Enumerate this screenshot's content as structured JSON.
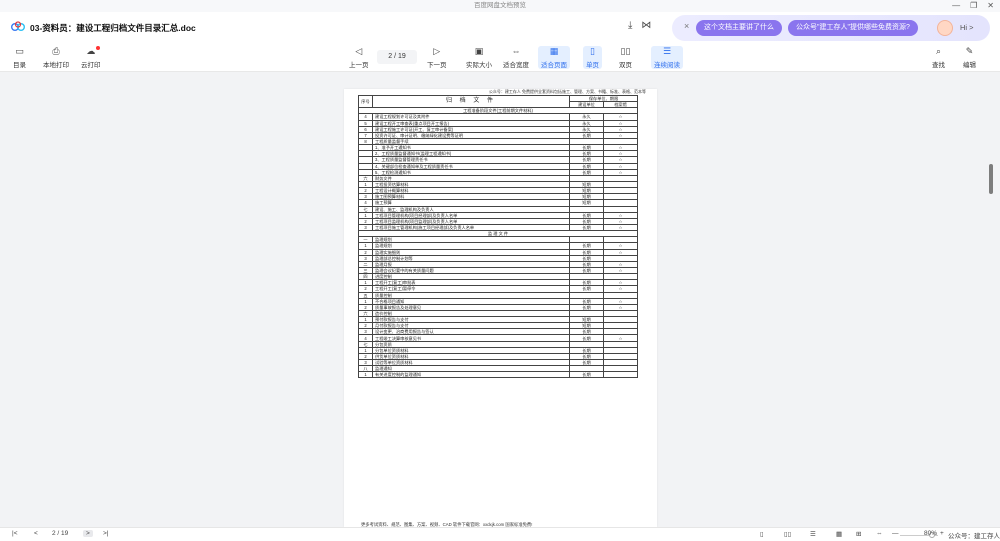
{
  "system": {
    "title": "百度网盘文档预览",
    "controls": [
      "—",
      "❐",
      "✕"
    ]
  },
  "app": {
    "doc_title": "03-资料员：建设工程归档文件目录汇总.doc",
    "title_icons": [
      "download-icon",
      "share-icon"
    ],
    "ai": {
      "close": "×",
      "q1": "这个文档主要讲了什么",
      "q2": "公众号\"建工存人\"提供哪些免费资源?",
      "hi": "Hi >"
    }
  },
  "toolbar": {
    "left": [
      {
        "name": "toc",
        "label": "目录",
        "icon": "▭"
      },
      {
        "name": "local-print",
        "label": "本地打印",
        "icon": "⎙"
      },
      {
        "name": "cloud-print",
        "label": "云打印",
        "icon": "☁"
      }
    ],
    "prev": {
      "label": "上一页",
      "icon": "◁"
    },
    "page_indicator": "2  /  19",
    "next": {
      "label": "下一页",
      "icon": "▷"
    },
    "view": [
      {
        "name": "actual-size",
        "label": "实际大小",
        "icon": "▣"
      },
      {
        "name": "fit-width",
        "label": "适合宽度",
        "icon": "⇔"
      },
      {
        "name": "fit-page",
        "label": "适合页面",
        "icon": "▦"
      },
      {
        "name": "single-page",
        "label": "单页",
        "icon": "▯"
      },
      {
        "name": "double-page",
        "label": "双页",
        "icon": "▯▯"
      },
      {
        "name": "continuous",
        "label": "连续阅读",
        "icon": "☰"
      }
    ],
    "right": [
      {
        "name": "find",
        "label": "查找",
        "icon": "⌕"
      },
      {
        "name": "edit",
        "label": "编辑",
        "icon": "✎"
      }
    ]
  },
  "doc": {
    "header_note": "公众号：建工存人 免费提供全套资料包括施工、管理、方案、书籍、标准、表格、范本等",
    "table_head": {
      "num": "序号",
      "title": "归 档 文 件",
      "keep": "保存单位、期限",
      "build": "建设单位",
      "archive": "档案馆"
    },
    "rows": [
      [
        "",
        "工程准备阶段文件(工程前期文件材料)",
        "",
        ""
      ],
      [
        "4",
        "建设工程规划许可证及其附件",
        "永久",
        "☆"
      ],
      [
        "5",
        "建设工程开工审查表(重点项目开工报告)",
        "永久",
        "☆"
      ],
      [
        "6",
        "建设工程施工许可证(开工、复工审计备案)",
        "永久",
        "☆"
      ],
      [
        "7",
        "投资许可证、审计证明、缴纳绿化建设费等证明",
        "长期",
        "☆"
      ],
      [
        "8",
        "工程质量监督手续",
        "",
        ""
      ],
      [
        "",
        "1、准予开工通知书",
        "长期",
        "☆"
      ],
      [
        "",
        "2、工程质量监督通知书(监理工程通知书)",
        "长期",
        "☆"
      ],
      [
        "",
        "3、工程质量监督管理责任书",
        "长期",
        "☆"
      ],
      [
        "",
        "4、关键部位检查通知单及工程质量责任书",
        "长期",
        "☆"
      ],
      [
        "",
        "5、工程检测通知书",
        "长期",
        "☆"
      ],
      [
        "六",
        "财务文件",
        "",
        ""
      ],
      [
        "1",
        "工程投资估算材料",
        "短期",
        ""
      ],
      [
        "2",
        "工程设计概算材料",
        "短期",
        ""
      ],
      [
        "3",
        "施工图预算材料",
        "短期",
        ""
      ],
      [
        "4",
        "施工预算",
        "短期",
        ""
      ],
      [
        "七",
        "建设、施工、监理机构及负责人",
        "",
        ""
      ],
      [
        "1",
        "工程项目管理机构(项目经理部)及负责人名单",
        "长期",
        "☆"
      ],
      [
        "2",
        "工程项目监理机构(项目监理部)及负责人名单",
        "长期",
        "☆"
      ],
      [
        "3",
        "工程项目施工管理机构(施工项目经理部)及负责人名单",
        "长期",
        "☆"
      ],
      [
        "",
        "监 理 文 件",
        "",
        ""
      ],
      [
        "一",
        "监理规划",
        "",
        ""
      ],
      [
        "1",
        "监理规划",
        "长期",
        "☆"
      ],
      [
        "2",
        "监理实施细则",
        "长期",
        "☆"
      ],
      [
        "3",
        "监理部总控制计划等",
        "长期",
        ""
      ],
      [
        "二",
        "监理月报",
        "长期",
        "☆"
      ],
      [
        "三",
        "监理会议纪要中的有关质量问题",
        "长期",
        "☆"
      ],
      [
        "四",
        "进度控制",
        "",
        ""
      ],
      [
        "1",
        "工程开工(复工)审批表",
        "长期",
        "☆"
      ],
      [
        "2",
        "工程开工(复工)暂停令",
        "长期",
        "☆"
      ],
      [
        "五",
        "质量控制",
        "",
        ""
      ],
      [
        "1",
        "不合格项目通知",
        "长期",
        "☆"
      ],
      [
        "2",
        "质量事故报告及处理意见",
        "长期",
        "☆"
      ],
      [
        "六",
        "造价控制",
        "",
        ""
      ],
      [
        "1",
        "预付款报告与支付",
        "短期",
        ""
      ],
      [
        "2",
        "月付款报告与支付",
        "短期",
        ""
      ],
      [
        "3",
        "设计变更、治商费用报告与签认",
        "长期",
        ""
      ],
      [
        "4",
        "工程竣工决算审核意见书",
        "长期",
        "☆"
      ],
      [
        "七",
        "分包资质",
        "",
        ""
      ],
      [
        "1",
        "分包单位资质材料",
        "长期",
        ""
      ],
      [
        "2",
        "供货单位资质材料",
        "长期",
        ""
      ],
      [
        "3",
        "试验等单位资质材料",
        "长期",
        ""
      ],
      [
        "八",
        "监理通知",
        "",
        ""
      ],
      [
        "1",
        "有关进度控制的监理通知",
        "长期",
        ""
      ]
    ],
    "footnote": "更多考试资料、规范、图集、方案、视频、CAD 软件下载官网：xxdxjk.com 国家标准免费!"
  },
  "bottom": {
    "first": "|<",
    "prev": "<",
    "page": "2  /  19",
    "next": ">",
    "last": ">|",
    "view_icons": [
      "▯",
      "▯▯",
      "☰",
      "▦",
      "⊞",
      "⇔",
      "⛶",
      "⤢",
      "—",
      "+"
    ],
    "zoom": "80%",
    "zoom_level": 0.8,
    "watermark": "公众号：建工存人"
  }
}
